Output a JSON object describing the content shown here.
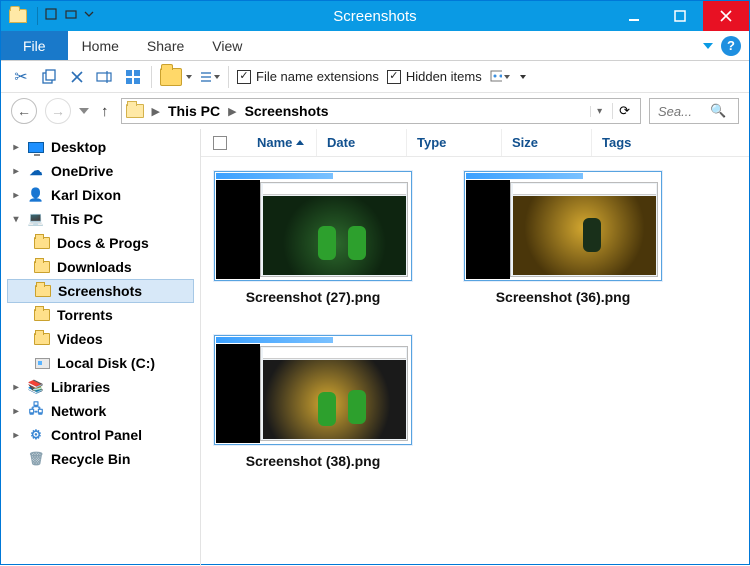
{
  "window": {
    "title": "Screenshots"
  },
  "menu": {
    "file": "File",
    "tabs": [
      "Home",
      "Share",
      "View"
    ]
  },
  "ribbon": {
    "ext_label": "File name extensions",
    "hidden_label": "Hidden items"
  },
  "address": {
    "segments": [
      "This PC",
      "Screenshots"
    ]
  },
  "search": {
    "placeholder": "Sea..."
  },
  "columns": [
    "Name",
    "Date",
    "Type",
    "Size",
    "Tags"
  ],
  "tree": {
    "desktop": "Desktop",
    "onedrive": "OneDrive",
    "user": "Karl Dixon",
    "thispc": "This PC",
    "docs": "Docs & Progs",
    "downloads": "Downloads",
    "screenshots": "Screenshots",
    "torrents": "Torrents",
    "videos": "Videos",
    "disk": "Local Disk (C:)",
    "libraries": "Libraries",
    "network": "Network",
    "cpanel": "Control Panel",
    "recycle": "Recycle Bin"
  },
  "files": [
    {
      "name": "Screenshot (27).png"
    },
    {
      "name": "Screenshot (36).png"
    },
    {
      "name": "Screenshot (38).png"
    }
  ]
}
